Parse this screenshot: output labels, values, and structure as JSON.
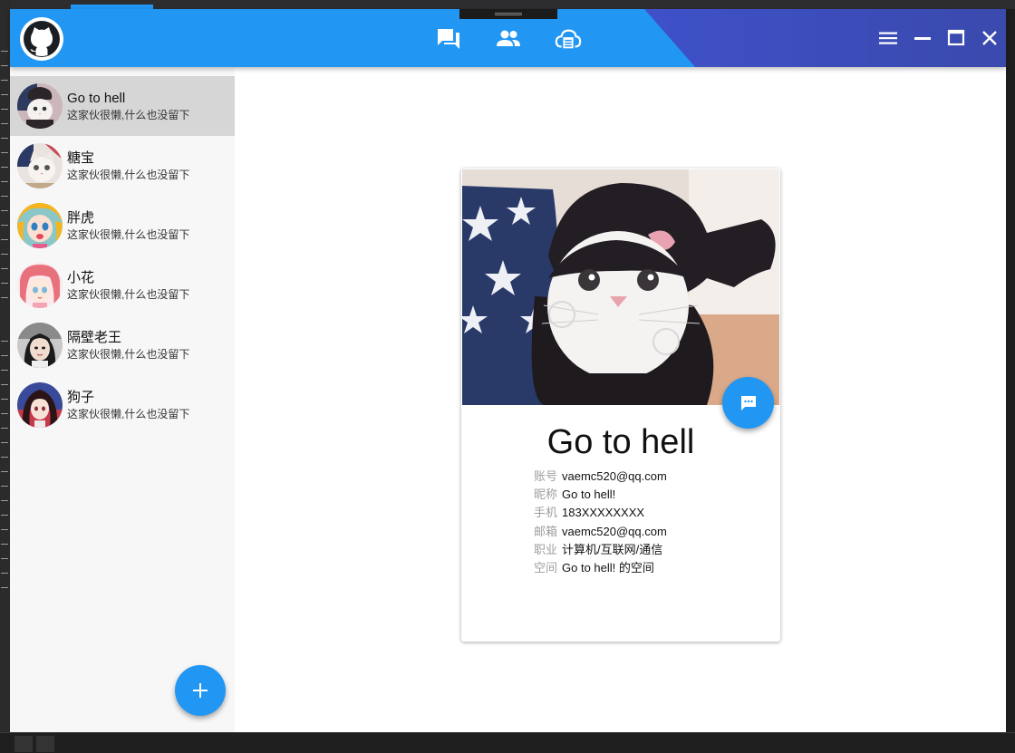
{
  "titlebar": {
    "nav_icons": [
      "chat-icon",
      "contacts-icon",
      "cloud-icon"
    ],
    "window_controls": [
      "menu-icon",
      "minimize-icon",
      "maximize-icon",
      "close-icon"
    ],
    "logo": "github-icon"
  },
  "colors": {
    "primary": "#2196f3",
    "accent_dark": "#3949ab",
    "selected_row": "#d6d6d6"
  },
  "contacts": [
    {
      "name": "Go to hell",
      "signature": "这家伙很懒,什么也没留下",
      "selected": true
    },
    {
      "name": "糖宝",
      "signature": "这家伙很懒,什么也没留下",
      "selected": false
    },
    {
      "name": "胖虎",
      "signature": "这家伙很懒,什么也没留下",
      "selected": false
    },
    {
      "name": "小花",
      "signature": "这家伙很懒,什么也没留下",
      "selected": false
    },
    {
      "name": "隔壁老王",
      "signature": "这家伙很懒,什么也没留下",
      "selected": false
    },
    {
      "name": "狗子",
      "signature": "这家伙很懒,什么也没留下",
      "selected": false
    }
  ],
  "sidebar": {
    "add_button_icon": "plus-icon"
  },
  "profile": {
    "name": "Go to hell",
    "chat_button_icon": "message-icon",
    "fields": [
      {
        "label": "账号",
        "value": "vaemc520@qq.com"
      },
      {
        "label": "昵称",
        "value": "Go to hell!"
      },
      {
        "label": "手机",
        "value": "183XXXXXXXX"
      },
      {
        "label": "邮箱",
        "value": "vaemc520@qq.com"
      },
      {
        "label": "职业",
        "value": "计算机/互联网/通信"
      },
      {
        "label": "空间",
        "value": "Go to hell! 的空间"
      }
    ]
  }
}
